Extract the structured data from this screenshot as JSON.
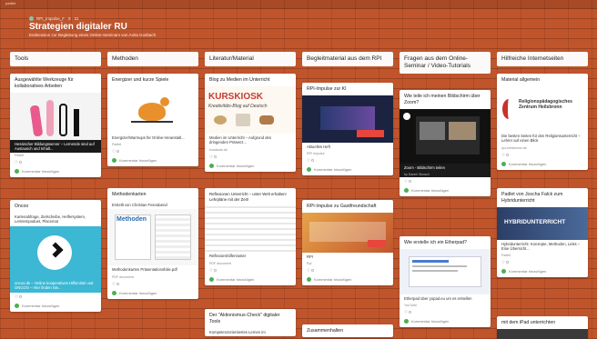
{
  "app": {
    "top_label": "padlet"
  },
  "board": {
    "crumb": "RPI_Impulse_F · 9 · 31",
    "title": "Strategien digitaler RU",
    "subtitle": "Endsession zur Begleitung eines Online-Seminars von Anita Gosbach"
  },
  "columns": [
    {
      "title": "Tools",
      "cards": [
        {
          "title": "Ausgewählte Werkzeuge für kollaboratives Arbeiten",
          "caption": "Hessischer Bildungsserver – Lernende sind auf Austausch und Inhalt...",
          "meta": "Padlet",
          "likes": "♡ 0",
          "comment": "Kommentar hinzufügen"
        },
        {
          "title": "Oncoo",
          "text": "Kartenabfrage, Zielscheibe, Helfersystem, Lerntempoduet, Placemat",
          "caption": "oncoo.de – Online kooperatives Hilfsmittel und ONCOO – Hier finden Sie...",
          "likes": "♡ 0",
          "comment": "Kommentar hinzufügen"
        }
      ]
    },
    {
      "title": "Methoden",
      "cards": [
        {
          "title": "Energizer und kurze Spiele",
          "caption": "Energizer/Warmups für Online-Veranstalt...",
          "meta": "Padlet",
          "likes": "♡ 0",
          "comment": "Kommentar hinzufügen"
        },
        {
          "title": "Methodenkarten",
          "text": "Erstellt von Christian Feierabend",
          "img_text": "Methoden",
          "caption": "Methodenkarten Präsentationsfolie.pdf",
          "meta": "PDF document",
          "likes": "♡ 0",
          "comment": "Kommentar hinzufügen"
        }
      ]
    },
    {
      "title": "Literatur/Material",
      "cards": [
        {
          "title": "Blog zu Medien im Unterricht",
          "img_title": "KURSKIOSK",
          "img_sub": "Kreativitäts-Blog auf Deutsch",
          "caption": "Medien im Unterricht – Aufgrund des dringenden Präsenz...",
          "meta": "kurskiosk.de",
          "likes": "♡ 0",
          "comment": "Kommentar hinzufügen"
        },
        {
          "title": "Reflexionen Unterricht – unter Welt erhalten! Lehrpläne mit der Zeit!",
          "caption": "Reflexionshilfenraster",
          "meta": "PDF document",
          "likes": "♡ 0",
          "comment": "Kommentar hinzufügen"
        },
        {
          "title": "Der \"Aktionismus-Check\" digitaler Tools",
          "text": "Kompetenzorientiertes Lernen im"
        }
      ]
    },
    {
      "title": "Begleitmaterial aus dem RPI",
      "cards": [
        {
          "title": "RPI-Impulse zur KI",
          "caption": "Aktuelles Heft",
          "meta": "RPI Impulse",
          "likes": "♡ 0",
          "comment": "Kommentar hinzufügen"
        },
        {
          "title": "RPI-Impulse zu Gastfreundschaft",
          "caption": "RPI",
          "meta": "Rpi",
          "likes": "♡ 0",
          "comment": "Kommentar hinzufügen"
        },
        {
          "title": "Zusammenhalten"
        }
      ]
    },
    {
      "title": "Fragen aus dem Online-Seminar / Video-Tutorials",
      "cards": [
        {
          "title": "Wie teile ich meinen Bildschirm über Zoom?",
          "caption": "Zoom - Bildschirm teilen",
          "meta": "by Daniel Sbosch",
          "likes": "♡ 0",
          "comment": "Kommentar hinzufügen"
        },
        {
          "title": "Wie erstelle ich ein Etherpad?",
          "caption": "Etherpad über yopad.eu um es erstellen",
          "meta": "YouTube",
          "likes": "♡ 0",
          "comment": "Kommentar hinzufügen"
        }
      ]
    },
    {
      "title": "Hilfreiche Internetseiten",
      "cards": [
        {
          "title": "Material allgemein",
          "img_text": "Religionspädagogisches Zentrum Heilsbronn",
          "caption": "Die besten Seiten für den Religionsunterricht – Lehrer auf einen Blick",
          "meta": "rpz-heilsbronn.de",
          "likes": "♡ 0",
          "comment": "Kommentar hinzufügen"
        },
        {
          "title": "Padlet von Joscha Falck zum Hybridunterricht",
          "img_text": "HYBRIDUNTERRICHT",
          "caption": "Hybridunterricht: Konzepte, Methoden, Links – Eine Übersicht...",
          "meta": "Padlet",
          "likes": "♡ 0",
          "comment": "Kommentar hinzufügen"
        },
        {
          "title": "mit dem iPad unterrichten"
        }
      ]
    }
  ],
  "colors": {
    "background": "#c0552c",
    "accent": "#e8453c",
    "green": "#4caf50"
  }
}
